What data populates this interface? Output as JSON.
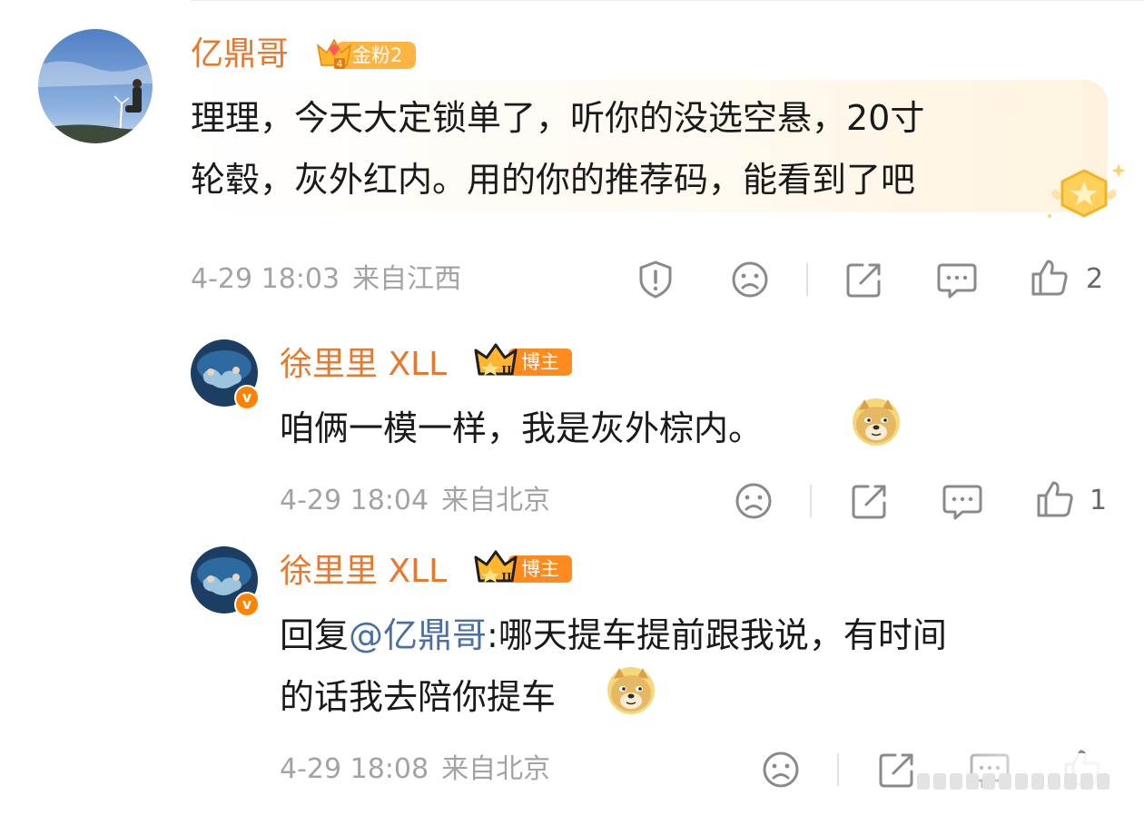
{
  "main_comment": {
    "username": "亿鼎哥",
    "fan_badge": "金粉2",
    "fan_badge_level": "4",
    "text_line1": "理理，今天大定锁单了，听你的没选空悬，20寸",
    "text_line2": "轮毂，灰外红内。用的你的推荐码，能看到了吧",
    "timestamp": "4-29 18:03",
    "location": "来自江西",
    "like_count": "2",
    "icons": [
      "report-icon",
      "dislike-icon",
      "share-icon",
      "comment-icon",
      "like-icon"
    ]
  },
  "replies": [
    {
      "username": "徐里里 XLL",
      "role_badge": "博主",
      "crown_level": "II",
      "text_line1": "咱俩一模一样，我是灰外棕内。",
      "timestamp": "4-29 18:04",
      "location": "来自北京",
      "like_count": "1"
    },
    {
      "username": "徐里里 XLL",
      "role_badge": "博主",
      "crown_level": "II",
      "text_prefix": "回复",
      "mention": "@亿鼎哥",
      "text_line1_rest": ":哪天提车提前跟我说，有时间",
      "text_line2": "的话我去陪你提车",
      "timestamp": "4-29 18:08",
      "location": "来自北京",
      "like_count": ""
    }
  ],
  "colors": {
    "username": "#e8782d",
    "meta_gray": "#a3a3a3",
    "mention_blue": "#4a6fa5",
    "badge_orange": "#ff8a1e",
    "fan_badge": "#ffb340"
  }
}
